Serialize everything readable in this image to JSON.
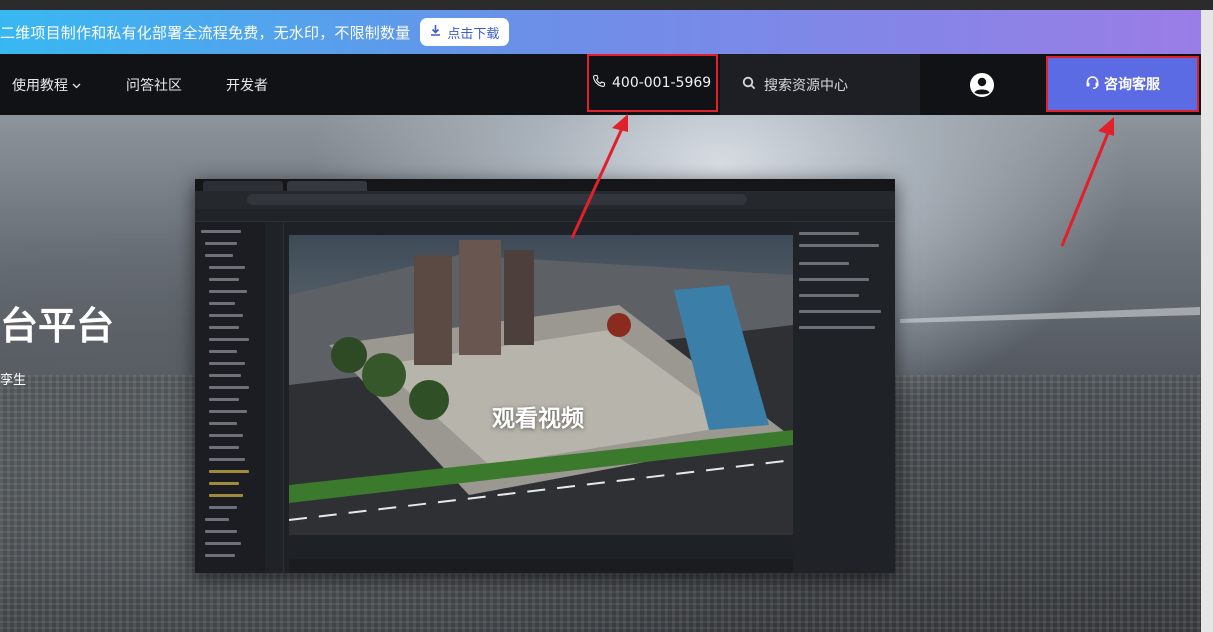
{
  "promo": {
    "text": "二维项目制作和私有化部署全流程免费，无水印，不限制数量",
    "download_label": "点击下载"
  },
  "nav": {
    "items": [
      {
        "label": "使用教程",
        "has_dropdown": true
      },
      {
        "label": "问答社区"
      },
      {
        "label": "开发者"
      }
    ],
    "phone": "400-001-5969",
    "search_placeholder": "搜索资源中心",
    "consult_label": "咨询客服"
  },
  "hero": {
    "title": "台平台",
    "subtitle": "孪生",
    "video_label": "观看视频"
  },
  "colors": {
    "nav_bg": "#111216",
    "consult_bg": "#5a6be3",
    "highlight_border": "#e0202a",
    "promo_gradient_start": "#38b8f2",
    "promo_gradient_end": "#9a7de6"
  }
}
